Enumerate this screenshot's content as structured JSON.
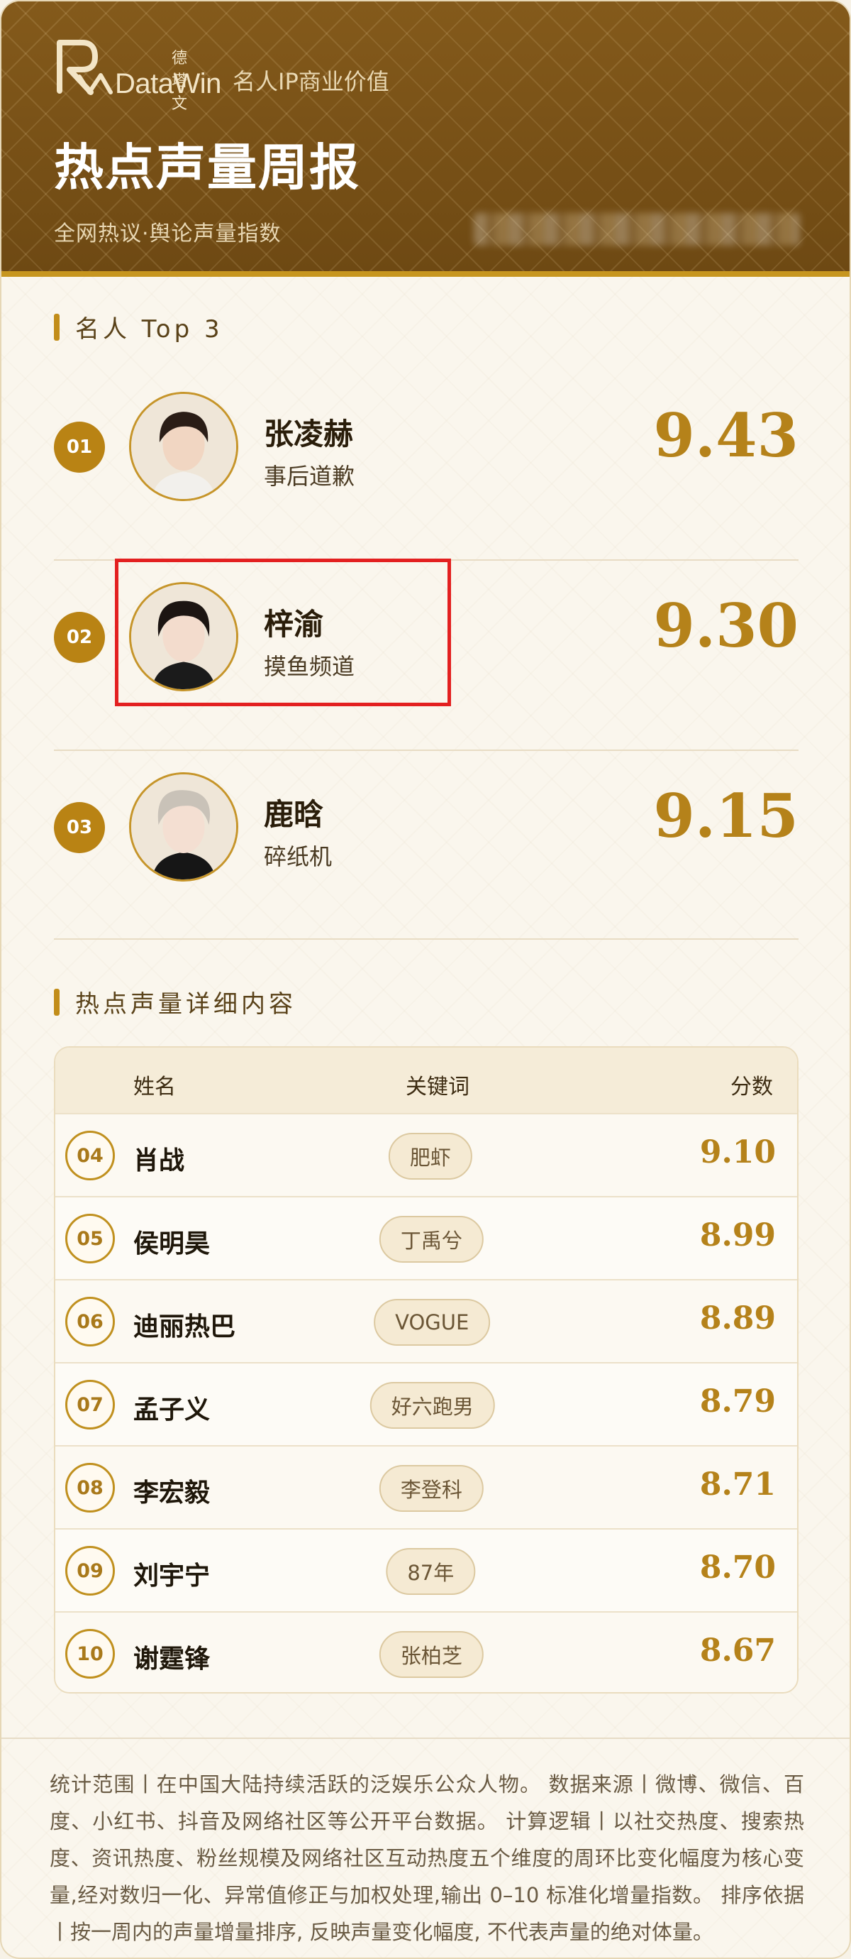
{
  "header": {
    "brand_logo_text": "DataWin",
    "brand_logo_cn": "德塔文",
    "brand_sub": "名人IP商业价值",
    "title": "热点声量周报",
    "subtitle": "全网热议·舆论声量指数"
  },
  "sections": {
    "top3_title": "名人 Top 3",
    "detail_title": "热点声量详细内容"
  },
  "top3": [
    {
      "rank": "01",
      "name": "张凌赫",
      "keyword": "事后道歉",
      "score": "9.43"
    },
    {
      "rank": "02",
      "name": "梓渝",
      "keyword": "摸鱼频道",
      "score": "9.30"
    },
    {
      "rank": "03",
      "name": "鹿晗",
      "keyword": "碎纸机",
      "score": "9.15"
    }
  ],
  "table": {
    "headers": {
      "name": "姓名",
      "keyword": "关键词",
      "score": "分数"
    },
    "rows": [
      {
        "rank": "04",
        "name": "肖战",
        "keyword": "肥虾",
        "score": "9.10"
      },
      {
        "rank": "05",
        "name": "侯明昊",
        "keyword": "丁禹兮",
        "score": "8.99"
      },
      {
        "rank": "06",
        "name": "迪丽热巴",
        "keyword": "VOGUE",
        "score": "8.89"
      },
      {
        "rank": "07",
        "name": "孟子义",
        "keyword": "好六跑男",
        "score": "8.79"
      },
      {
        "rank": "08",
        "name": "李宏毅",
        "keyword": "李登科",
        "score": "8.71"
      },
      {
        "rank": "09",
        "name": "刘宇宁",
        "keyword": "87年",
        "score": "8.70"
      },
      {
        "rank": "10",
        "name": "谢霆锋",
        "keyword": "张柏芝",
        "score": "8.67"
      }
    ]
  },
  "footnote": "统计范围丨在中国大陆持续活跃的泛娱乐公众人物。 数据来源丨微博、微信、百度、小红书、抖音及网络社区等公开平台数据。 计算逻辑丨以社交热度、搜索热度、资讯热度、粉丝规模及网络社区互动热度五个维度的周环比变化幅度为核心变量,经对数归一化、异常值修正与加权处理,输出 0–10 标准化增量指数。 排序依据丨按一周内的声量增量排序, 反映声量变化幅度, 不代表声量的绝对体量。",
  "colors": {
    "header_brown": "#7b5317",
    "gold_accent": "#b5821a",
    "highlight_red": "#e32020"
  }
}
